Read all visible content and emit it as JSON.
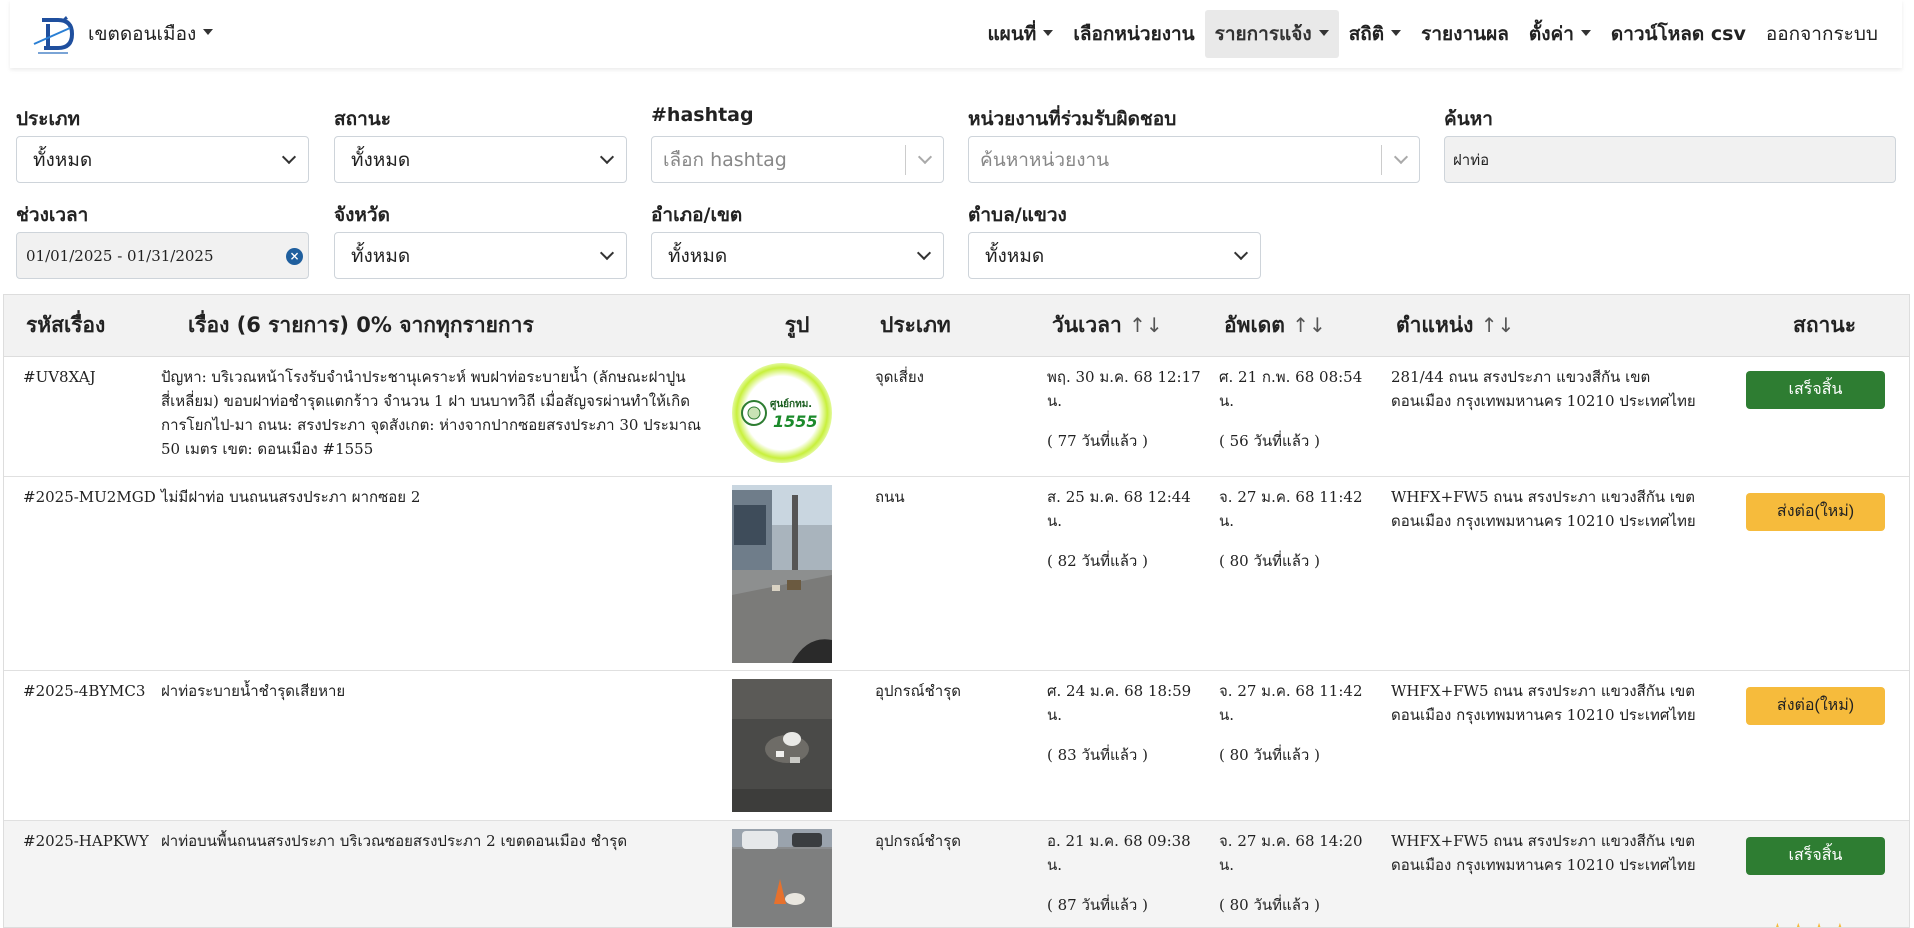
{
  "navbar": {
    "brand_name": "เขตดอนเมือง",
    "items": [
      {
        "label": "แผนที่",
        "dropdown": true
      },
      {
        "label": "เลือกหน่วยงาน",
        "dropdown": false
      },
      {
        "label": "รายการแจ้ง",
        "dropdown": true,
        "active": true
      },
      {
        "label": "สถิติ",
        "dropdown": true
      },
      {
        "label": "รายงานผล",
        "dropdown": false
      },
      {
        "label": "ตั้งค่า",
        "dropdown": true
      },
      {
        "label": "ดาวน์โหลด csv",
        "dropdown": false
      },
      {
        "label": "ออกจากระบบ",
        "dropdown": false
      }
    ]
  },
  "filters": {
    "type": {
      "label": "ประเภท",
      "value": "ทั้งหมด"
    },
    "status": {
      "label": "สถานะ",
      "value": "ทั้งหมด"
    },
    "hashtag": {
      "label": "#hashtag",
      "placeholder": "เลือก hashtag"
    },
    "agency": {
      "label": "หน่วยงานที่ร่วมรับผิดชอบ",
      "placeholder": "ค้นหาหน่วยงาน"
    },
    "search": {
      "label": "ค้นหา",
      "value": "ฝาท่อ"
    },
    "period": {
      "label": "ช่วงเวลา",
      "value": "01/01/2025 - 01/31/2025"
    },
    "province": {
      "label": "จังหวัด",
      "value": "ทั้งหมด"
    },
    "district": {
      "label": "อำเภอ/เขต",
      "value": "ทั้งหมด"
    },
    "subdistrict": {
      "label": "ตำบล/แขวง",
      "value": "ทั้งหมด"
    }
  },
  "table": {
    "headers": {
      "id": "รหัสเรื่อง",
      "title": "เรื่อง (6 รายการ) 0% จากทุกรายการ",
      "image": "รูป",
      "type": "ประเภท",
      "datetime": "วันเวลา",
      "updated": "อัพเดต",
      "location": "ตำแหน่ง",
      "status": "สถานะ",
      "sort_glyph": "↑↓"
    },
    "rows": [
      {
        "id": "#UV8XAJ",
        "title": "ปัญหา: บริเวณหน้าโรงรับจำนำประชานุเคราะห์ พบฝาท่อระบายน้ำ (ลักษณะฝาปูนสี่เหลี่ยม) ขอบฝาท่อชำรุดแตกร้าว จำนวน 1 ฝา บนบาทวิถี เมื่อสัญจรผ่านทำให้เกิดการโยกไป-มา ถนน: สรงประภา จุดสังเกต: ห่างจากปากซอยสรงประภา 30 ประมาณ 50 เมตร เขต: ดอนเมือง #1555",
        "image": "badge-1555",
        "badge_text": "ศูนย์กทม.",
        "badge_number": "1555",
        "type": "จุดเสี่ยง",
        "datetime": "พฤ. 30 ม.ค. 68 12:17 น.",
        "datetime_ago": "( 77 วันที่แล้ว )",
        "updated": "ศ. 21 ก.พ. 68 08:54 น.",
        "updated_ago": "( 56 วันที่แล้ว )",
        "location": "281/44 ถนน สรงประภา แขวงสีกัน เขตดอนเมือง กรุงเทพมหานคร 10210 ประเทศไทย",
        "status": "เสร็จสิ้น",
        "status_kind": "done",
        "status_color": "#2e7d32"
      },
      {
        "id": "#2025-MU2MGD",
        "title": "ไม่มีฝาท่อ บนถนนสรงประภา ผากซอย 2",
        "image": "street-photo",
        "type": "ถนน",
        "datetime": "ส. 25 ม.ค. 68 12:44 น.",
        "datetime_ago": "( 82 วันที่แล้ว )",
        "updated": "จ. 27 ม.ค. 68 11:42 น.",
        "updated_ago": "( 80 วันที่แล้ว )",
        "location": "WHFX+FW5 ถนน สรงประภา แขวงสีกัน เขตดอนเมือง กรุงเทพมหานคร 10210 ประเทศไทย",
        "status": "ส่งต่อ(ใหม่)",
        "status_kind": "new",
        "status_color": "#f6bb3c"
      },
      {
        "id": "#2025-4BYMC3",
        "title": "ฝาท่อระบายน้ำชำรุดเสียหาย",
        "image": "manhole-photo",
        "type": "อุปกรณ์ชำรุด",
        "datetime": "ศ. 24 ม.ค. 68 18:59 น.",
        "datetime_ago": "( 83 วันที่แล้ว )",
        "updated": "จ. 27 ม.ค. 68 11:42 น.",
        "updated_ago": "( 80 วันที่แล้ว )",
        "location": "WHFX+FW5 ถนน สรงประภา แขวงสีกัน เขตดอนเมือง กรุงเทพมหานคร 10210 ประเทศไทย",
        "status": "ส่งต่อ(ใหม่)",
        "status_kind": "new",
        "status_color": "#f6bb3c"
      },
      {
        "id": "#2025-HAPKWY",
        "title": "ฝาท่อบนพื้นถนนสรงประภา บริเวณซอยสรงประภา 2 เขตดอนเมือง ชำรุด",
        "image": "road-cone-photo",
        "type": "อุปกรณ์ชำรุด",
        "datetime": "อ. 21 ม.ค. 68 09:38 น.",
        "datetime_ago": "( 87 วันที่แล้ว )",
        "updated": "จ. 27 ม.ค. 68 14:20 น.",
        "updated_ago": "( 80 วันที่แล้ว )",
        "location": "WHFX+FW5 ถนน สรงประภา แขวงสีกัน เขตดอนเมือง กรุงเทพมหานคร 10210 ประเทศไทย",
        "status": "เสร็จสิ้น",
        "status_kind": "done",
        "status_color": "#2e7d32",
        "rating_stars": 4
      }
    ]
  }
}
